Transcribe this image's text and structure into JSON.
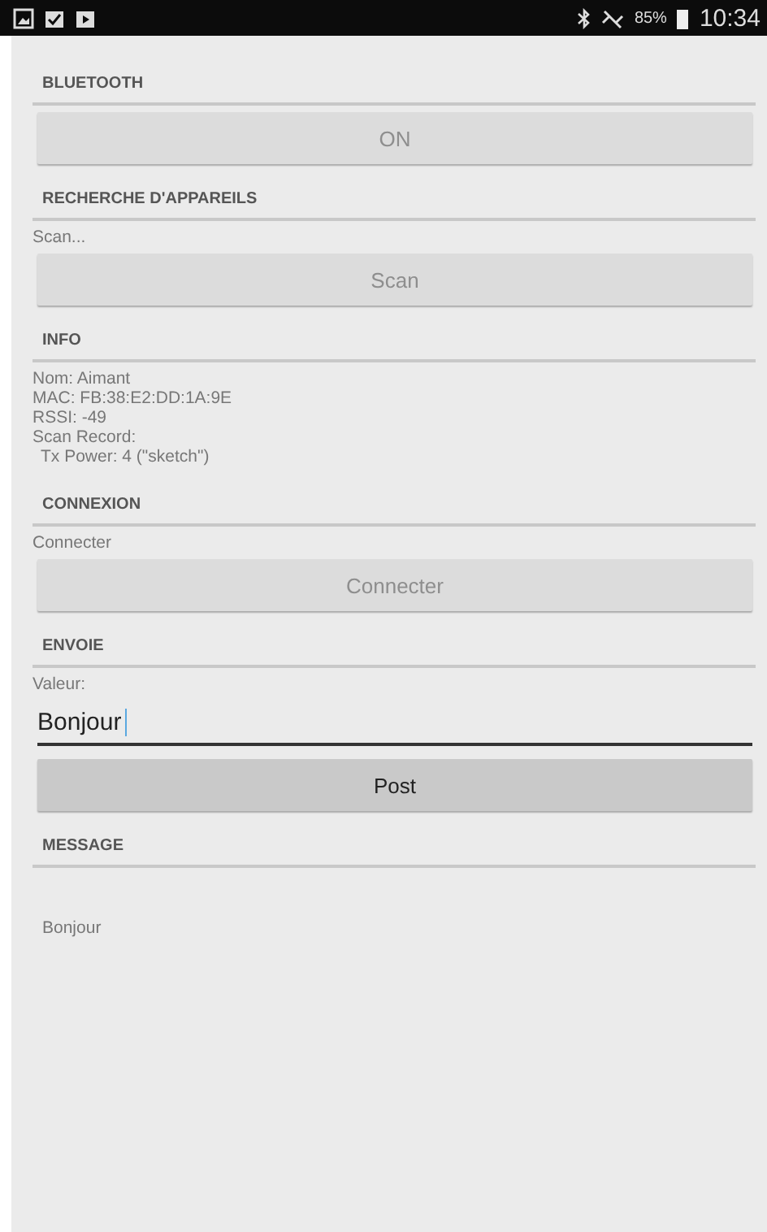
{
  "status_bar": {
    "battery": "85%",
    "time": "10:34"
  },
  "sections": [
    {
      "title": "BLUETOOTH",
      "items": [
        {
          "kind": "button",
          "label": "ON",
          "disabled": true
        }
      ]
    },
    {
      "title": "RECHERCHE D'APPAREILS",
      "items": [
        {
          "kind": "text",
          "text": "Scan..."
        },
        {
          "kind": "button",
          "label": "Scan",
          "disabled": true
        }
      ]
    },
    {
      "title": "INFO",
      "items": [
        {
          "kind": "lines",
          "lines": [
            {
              "text": "Nom: Aimant",
              "indented": false
            },
            {
              "text": "MAC: FB:38:E2:DD:1A:9E",
              "indented": false
            },
            {
              "text": "RSSI: -49",
              "indented": false
            },
            {
              "text": "Scan Record:",
              "indented": false
            },
            {
              "text": "Tx Power: 4 (\"sketch\")",
              "indented": true
            }
          ]
        }
      ]
    },
    {
      "title": "CONNEXION",
      "items": [
        {
          "kind": "text",
          "text": "Connecter"
        },
        {
          "kind": "button",
          "label": "Connecter",
          "disabled": true
        }
      ]
    },
    {
      "title": "ENVOIE",
      "items": [
        {
          "kind": "text",
          "text": "Valeur:"
        },
        {
          "kind": "field",
          "value": "Bonjour"
        },
        {
          "kind": "button",
          "label": "Post",
          "disabled": false
        }
      ]
    },
    {
      "title": "MESSAGE",
      "items": [
        {
          "kind": "message",
          "text": "Bonjour"
        }
      ]
    }
  ]
}
